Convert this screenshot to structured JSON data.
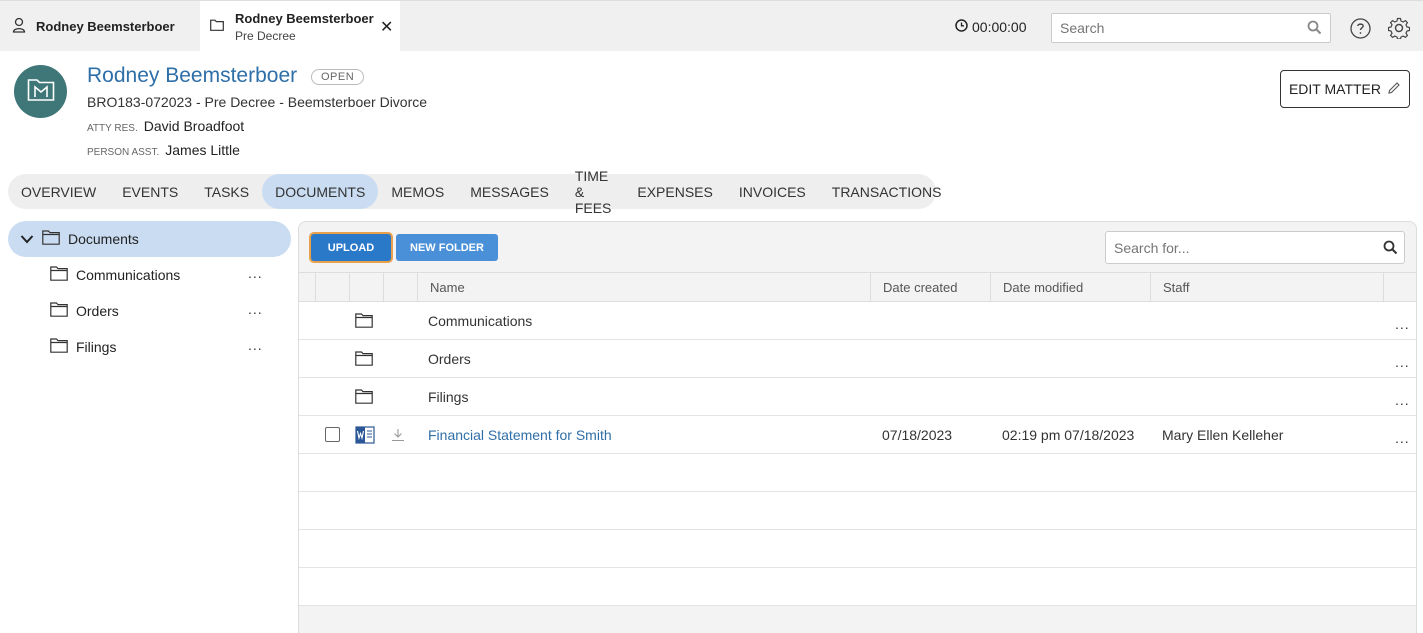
{
  "topbar": {
    "tab_user_label": "Rodney Beemsterboer",
    "tab_matter_title": "Rodney Beemsterboer",
    "tab_matter_subtitle": "Pre Decree",
    "tab_close": "✕",
    "timer": "00:00:00",
    "search_placeholder": "Search"
  },
  "matter": {
    "name": "Rodney Beemsterboer",
    "status": "OPEN",
    "case_line": "BRO183-072023 - Pre Decree - Beemsterboer Divorce",
    "atty_label": "ATTY RES.",
    "atty_value": "David Broadfoot",
    "asst_label": "PERSON ASST.",
    "asst_value": "James Little",
    "edit_button": "EDIT MATTER"
  },
  "nav": {
    "tabs": [
      {
        "label": "OVERVIEW",
        "active": false
      },
      {
        "label": "EVENTS",
        "active": false
      },
      {
        "label": "TASKS",
        "active": false
      },
      {
        "label": "DOCUMENTS",
        "active": true
      },
      {
        "label": "MEMOS",
        "active": false
      },
      {
        "label": "MESSAGES",
        "active": false
      },
      {
        "label": "TIME & FEES",
        "active": false
      },
      {
        "label": "EXPENSES",
        "active": false
      },
      {
        "label": "INVOICES",
        "active": false
      },
      {
        "label": "TRANSACTIONS",
        "active": false
      }
    ]
  },
  "tree": {
    "root": "Documents",
    "items": [
      {
        "label": "Communications",
        "menu": "..."
      },
      {
        "label": "Orders",
        "menu": "..."
      },
      {
        "label": "Filings",
        "menu": "..."
      }
    ]
  },
  "toolbar": {
    "upload": "UPLOAD",
    "new_folder": "NEW FOLDER",
    "search_placeholder": "Search for..."
  },
  "table": {
    "columns": {
      "name": "Name",
      "date_created": "Date created",
      "date_modified": "Date modified",
      "staff": "Staff"
    },
    "rows": [
      {
        "kind": "folder",
        "name": "Communications",
        "date_created": "",
        "date_modified": "",
        "staff": "",
        "menu": "..."
      },
      {
        "kind": "folder",
        "name": "Orders",
        "date_created": "",
        "date_modified": "",
        "staff": "",
        "menu": "..."
      },
      {
        "kind": "folder",
        "name": "Filings",
        "date_created": "",
        "date_modified": "",
        "staff": "",
        "menu": "..."
      },
      {
        "kind": "file",
        "name": "Financial Statement for Smith",
        "date_created": "07/18/2023",
        "date_modified": "02:19 pm 07/18/2023",
        "staff": "Mary Ellen Kelleher",
        "menu": "..."
      }
    ]
  },
  "colors": {
    "accent": "#2f6fa8",
    "active_tab": "#c9dcf2",
    "upload": "#2a79c9",
    "avatar": "#3f7678"
  }
}
